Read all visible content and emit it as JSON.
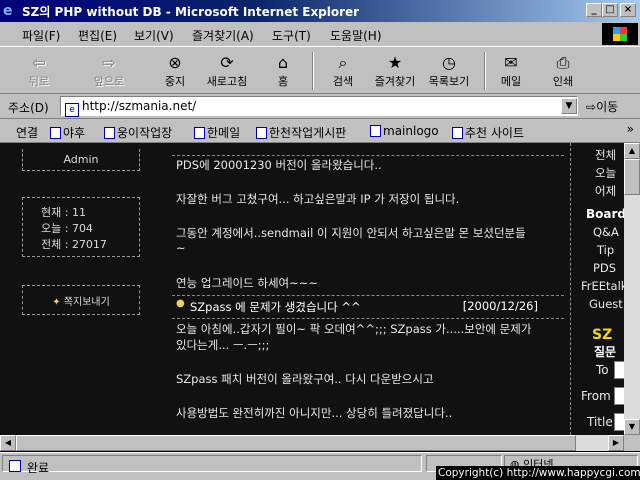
{
  "window": {
    "title": "SZ의 PHP without DB - Microsoft Internet Explorer",
    "minimize": "_",
    "maximize": "□",
    "close": "×"
  },
  "menu": [
    "파일(F)",
    "편집(E)",
    "보기(V)",
    "즐겨찾기(A)",
    "도구(T)",
    "도움말(H)"
  ],
  "toolbar": {
    "back": "뒤로",
    "forward": "앞으로",
    "stop": "중지",
    "refresh": "새로고침",
    "home": "홈",
    "search": "검색",
    "favorites": "즐겨찾기",
    "history": "목록보기",
    "mail": "메일",
    "print": "인쇄"
  },
  "address": {
    "label": "주소(D)",
    "url": "http://szmania.net/",
    "go": "이동"
  },
  "links": {
    "label": "연결",
    "items": [
      "야후",
      "웅이작업장",
      "한메일",
      "한천작업게시판",
      "mainlogo",
      "추천 사이트"
    ],
    "more": "»"
  },
  "sidebar": {
    "admin": "Admin",
    "stats": [
      "현재 : 11",
      "오늘 : 704",
      "전체 : 27017"
    ],
    "message": "쪽지보내기"
  },
  "posts": {
    "p1_lines": [
      "PDS에 20001230 버전이 올라왔습니다..",
      "자잘한 버그 고쳤구여... 하고싶은말과 IP 가 저장이 됩니다.",
      "그동안 계정에서..sendmail 이 지원이 안되서 하고싶은말 몬 보셨던분들",
      "~",
      "연능 업그레이드 하세여~~~"
    ],
    "p2_title": "SZpass 에 문제가 생겼습니다 ^^",
    "p2_date": "[2000/12/26]",
    "p2_lines": [
      "오늘 아침에..갑자기 필이~ 팍 오데여^^;;; SZpass 가.....보안에 문제가",
      "있다는게... ㅡ.ㅡ;;;",
      "SZpass 패치 버전이 올라왔구여.. 다시 다운받으시고",
      "사용방법도 완전히까진 아니지만... 상당히 틀려졌답니다.."
    ]
  },
  "rightcol": {
    "top_items": [
      "전체",
      "오늘",
      "어제"
    ],
    "board": "Board",
    "board_items": [
      "Q&A",
      "Tip",
      "PDS",
      "FrEEtalk",
      "Guest"
    ],
    "sz": "SZ",
    "sub": "질문",
    "form_labels": [
      "To",
      "From",
      "Title"
    ]
  },
  "status": {
    "text": "완료",
    "zone": "인터넷"
  },
  "copyright": "Copyright(c) http://www.happycgi.com"
}
